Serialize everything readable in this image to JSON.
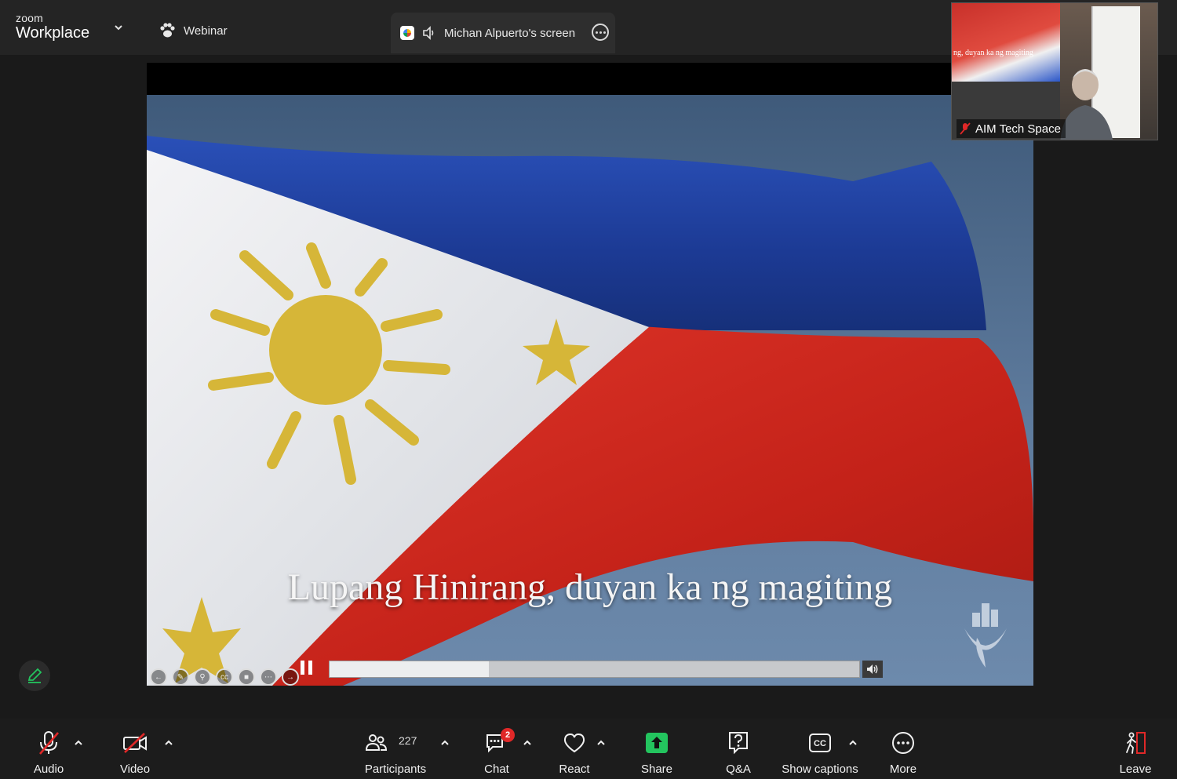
{
  "app": {
    "logo_small": "zoom",
    "logo_big": "Workplace",
    "mode_label": "Webinar"
  },
  "share": {
    "title": "Michan Alpuerto's screen"
  },
  "video": {
    "lyric": "Lupang Hinirang, duyan ka ng magiting",
    "progress_fraction": 0.3
  },
  "thumbnail": {
    "name": "AIM Tech Space",
    "slide_text": "ng, duyan ka ng magiting"
  },
  "toolbar": {
    "audio": "Audio",
    "video": "Video",
    "participants": "Participants",
    "participants_count": "227",
    "chat": "Chat",
    "chat_badge": "2",
    "react": "React",
    "share": "Share",
    "qa": "Q&A",
    "captions": "Show captions",
    "more": "More",
    "leave": "Leave"
  },
  "colors": {
    "share_green": "#23c45e",
    "mute_red": "#e02828",
    "flag_blue": "#1e3f9a",
    "flag_red": "#d6281f",
    "flag_gold": "#d6b638"
  }
}
